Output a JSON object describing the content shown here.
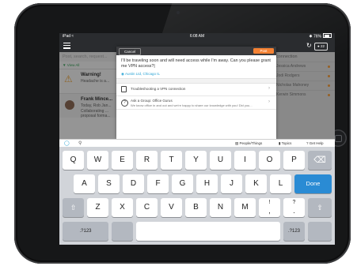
{
  "status_bar": {
    "carrier": "iPad",
    "time": "6:08 AM",
    "battery": "76%"
  },
  "app_bar": {
    "badge_count": "22"
  },
  "background": {
    "search_placeholder": "Post, search, request...",
    "filter_label": "View All",
    "messages": [
      {
        "title": "Warning!",
        "line1": "Headache is a..."
      },
      {
        "title": "Frank Mince...",
        "line1": "Today, Rob Jan...",
        "line2": "Collaborating ...",
        "line3": "proposal forma..."
      }
    ],
    "right_header": "connection",
    "contacts": [
      "Jessica Andrews",
      "Jodi Rodgers",
      "Nicholas Mahoney",
      "Kerwin Simmons"
    ]
  },
  "modal": {
    "cancel_label": "Cancel",
    "post_label": "Post",
    "question": "I'll be traveling soon and will need access while I'm away. Can you please grant me VPN access?|",
    "location": "Austin Ltd, Chicago IL",
    "suggestions": [
      {
        "title": "Troubleshooting a VPN connection",
        "subtitle": "",
        "icon": "document-icon"
      },
      {
        "title": "Ask a Group: Office Gurus",
        "subtitle": "We know office in and out and we're happy to share our knowledge with you! Did you...",
        "icon": "help-icon"
      }
    ]
  },
  "keyboard_toolbar": {
    "people_label": "People/Things",
    "topics_label": "Topics",
    "help_label": "Get Help"
  },
  "keyboard": {
    "row1": [
      "Q",
      "W",
      "E",
      "R",
      "T",
      "Y",
      "U",
      "I",
      "O",
      "P"
    ],
    "row2": [
      "A",
      "S",
      "D",
      "F",
      "G",
      "H",
      "J",
      "K",
      "L"
    ],
    "row3": [
      "Z",
      "X",
      "C",
      "V",
      "B",
      "N",
      "M"
    ],
    "row3_punct": [
      {
        "top": "!",
        "main": ","
      },
      {
        "top": "?",
        "main": "."
      }
    ],
    "done_label": "Done",
    "numbers_label": ".?123"
  },
  "colors": {
    "accent": "#2aa3d4",
    "post": "#f58233",
    "done": "#2a8bd4",
    "warning": "#e6a23c"
  }
}
